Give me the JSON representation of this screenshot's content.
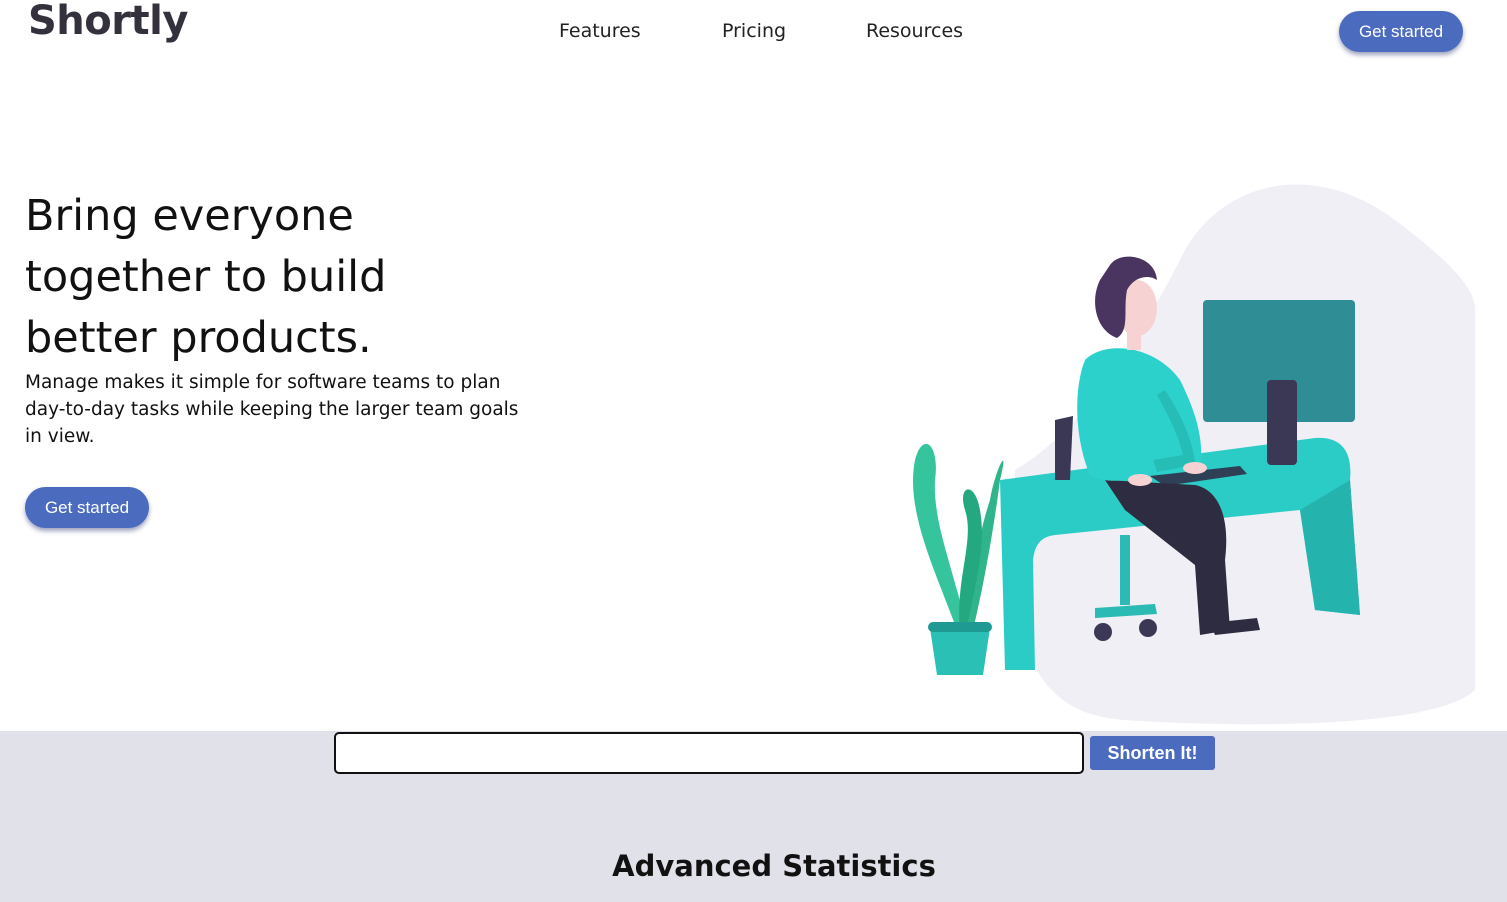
{
  "brand": {
    "logo_text": "Shortly",
    "accent_color": "#4b6bbf"
  },
  "nav": {
    "items": [
      {
        "label": "Features"
      },
      {
        "label": "Pricing"
      },
      {
        "label": "Resources"
      }
    ],
    "cta_label": "Get started"
  },
  "hero": {
    "title": "Bring everyone together to build better products.",
    "subtitle": "Manage makes it simple for software teams to plan day-to-day tasks while keeping the larger team goals in view.",
    "cta_label": "Get started",
    "illustration_icon": "person-at-desk-illustration"
  },
  "shorten": {
    "input_value": "",
    "input_placeholder": "",
    "button_label": "Shorten It!",
    "band_color": "#e1e1ea"
  },
  "stats": {
    "heading": "Advanced Statistics"
  }
}
